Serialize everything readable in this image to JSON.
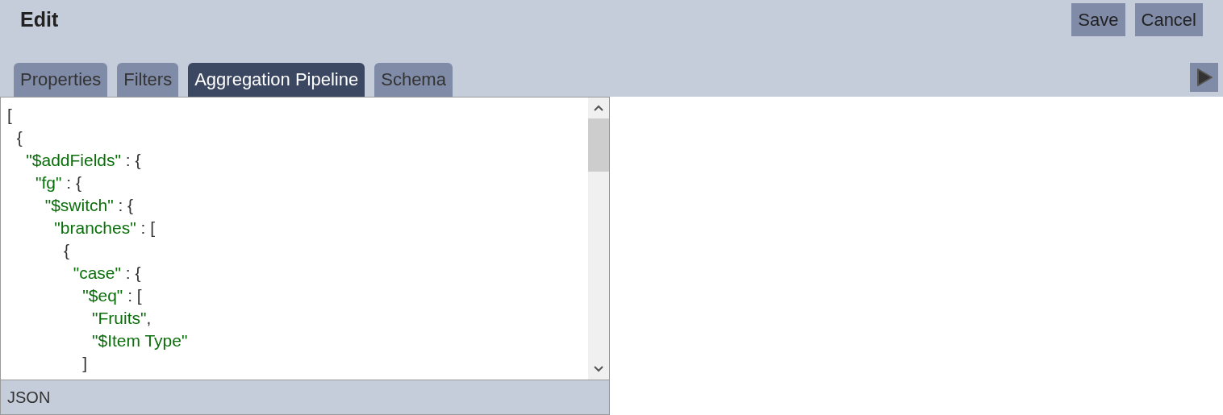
{
  "header": {
    "title": "Edit",
    "buttons": [
      "Save",
      "Cancel"
    ]
  },
  "tabs": [
    {
      "label": "Properties",
      "selected": false
    },
    {
      "label": "Filters",
      "selected": false
    },
    {
      "label": "Aggregation Pipeline",
      "selected": true
    },
    {
      "label": "Schema",
      "selected": false
    }
  ],
  "editor": {
    "lines": [
      [
        {
          "kind": "punct",
          "text": "["
        }
      ],
      [
        {
          "kind": "punct",
          "text": "  {"
        }
      ],
      [
        {
          "kind": "string",
          "text": "    \"$addFields\""
        },
        {
          "kind": "punct",
          "text": " : {"
        }
      ],
      [
        {
          "kind": "string",
          "text": "      \"fg\""
        },
        {
          "kind": "punct",
          "text": " : {"
        }
      ],
      [
        {
          "kind": "string",
          "text": "        \"$switch\""
        },
        {
          "kind": "punct",
          "text": " : {"
        }
      ],
      [
        {
          "kind": "string",
          "text": "          \"branches\""
        },
        {
          "kind": "punct",
          "text": " : ["
        }
      ],
      [
        {
          "kind": "punct",
          "text": "            {"
        }
      ],
      [
        {
          "kind": "string",
          "text": "              \"case\""
        },
        {
          "kind": "punct",
          "text": " : {"
        }
      ],
      [
        {
          "kind": "string",
          "text": "                \"$eq\""
        },
        {
          "kind": "punct",
          "text": " : ["
        }
      ],
      [
        {
          "kind": "string",
          "text": "                  \"Fruits\""
        },
        {
          "kind": "punct",
          "text": ","
        }
      ],
      [
        {
          "kind": "string",
          "text": "                  \"$Item Type\""
        }
      ],
      [
        {
          "kind": "punct",
          "text": "                ]"
        }
      ]
    ],
    "mode": "JSON"
  }
}
